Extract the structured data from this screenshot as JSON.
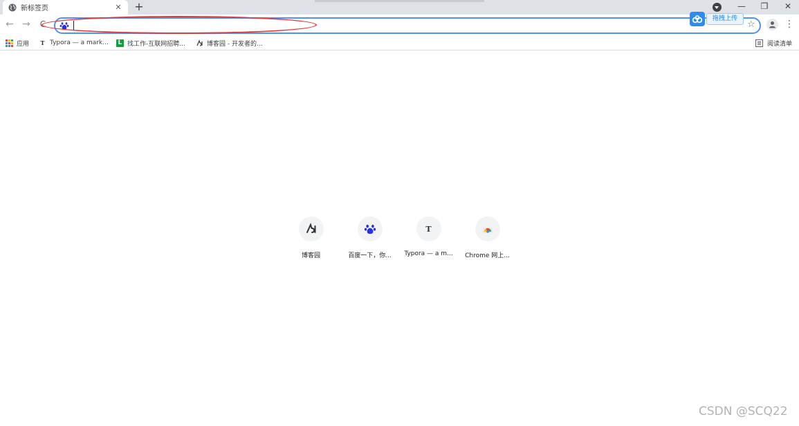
{
  "tab": {
    "title": "新标签页",
    "close": "✕"
  },
  "tabstrip": {
    "new_tab": "+",
    "minimize": "—",
    "restore": "❐",
    "close_window": "✕"
  },
  "toolbar": {
    "back": "←",
    "forward": "→",
    "reload": "C",
    "omnibox_value": "",
    "omnibox_placeholder": "",
    "star": "☆",
    "menu": "⋮"
  },
  "upload_popup": {
    "label": "拖拽上传"
  },
  "bookmarks": {
    "items": [
      {
        "label": "应用",
        "icon": "apps-grid-icon"
      },
      {
        "label": "Typora — a mark...",
        "icon": "typora-icon",
        "glyph": "T"
      },
      {
        "label": "找工作-互联网招聘...",
        "icon": "lagou-l-icon",
        "glyph": "L"
      },
      {
        "label": "博客园 - 开发者的...",
        "icon": "cnblogs-icon"
      }
    ],
    "reading_list": "阅读清单"
  },
  "shortcuts": [
    {
      "label": "博客园",
      "icon": "cnblogs-icon"
    },
    {
      "label": "百度一下，你...",
      "icon": "baidu-paw-icon"
    },
    {
      "label": "Typora — a m...",
      "icon": "typora-icon",
      "glyph": "T"
    },
    {
      "label": "Chrome 网上...",
      "icon": "chrome-webstore-icon"
    }
  ],
  "watermark": "CSDN @SCQ22",
  "colors": {
    "accent": "#4d90fe",
    "annotation_red": "#e53935",
    "baidu_blue": "#2932e1"
  }
}
